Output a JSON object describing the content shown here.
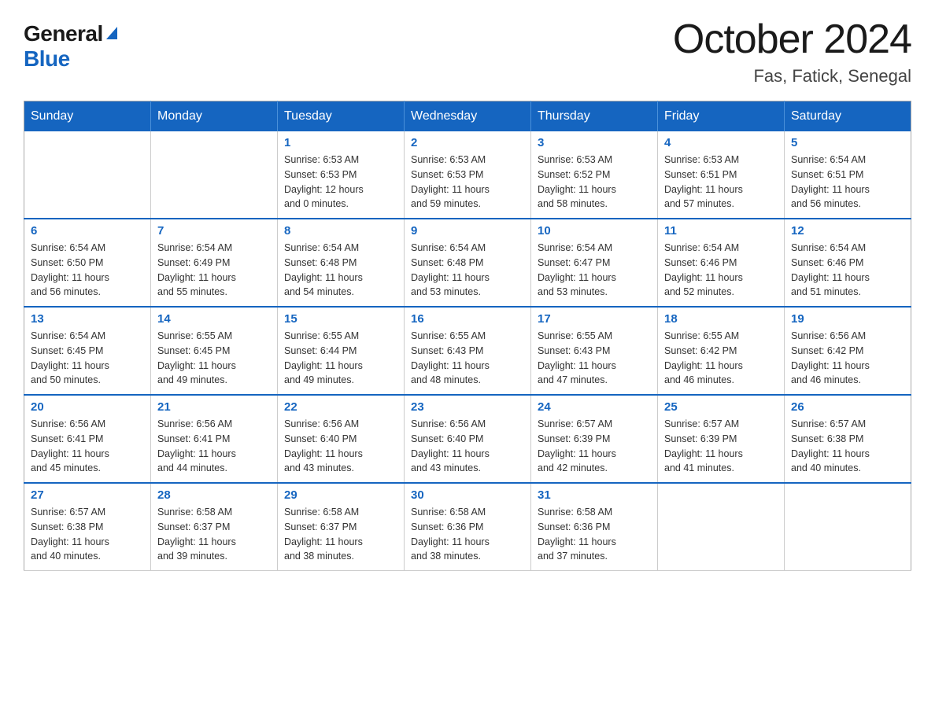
{
  "header": {
    "logo_general": "General",
    "logo_blue": "Blue",
    "title": "October 2024",
    "subtitle": "Fas, Fatick, Senegal"
  },
  "weekdays": [
    "Sunday",
    "Monday",
    "Tuesday",
    "Wednesday",
    "Thursday",
    "Friday",
    "Saturday"
  ],
  "weeks": [
    [
      {
        "day": "",
        "info": ""
      },
      {
        "day": "",
        "info": ""
      },
      {
        "day": "1",
        "info": "Sunrise: 6:53 AM\nSunset: 6:53 PM\nDaylight: 12 hours\nand 0 minutes."
      },
      {
        "day": "2",
        "info": "Sunrise: 6:53 AM\nSunset: 6:53 PM\nDaylight: 11 hours\nand 59 minutes."
      },
      {
        "day": "3",
        "info": "Sunrise: 6:53 AM\nSunset: 6:52 PM\nDaylight: 11 hours\nand 58 minutes."
      },
      {
        "day": "4",
        "info": "Sunrise: 6:53 AM\nSunset: 6:51 PM\nDaylight: 11 hours\nand 57 minutes."
      },
      {
        "day": "5",
        "info": "Sunrise: 6:54 AM\nSunset: 6:51 PM\nDaylight: 11 hours\nand 56 minutes."
      }
    ],
    [
      {
        "day": "6",
        "info": "Sunrise: 6:54 AM\nSunset: 6:50 PM\nDaylight: 11 hours\nand 56 minutes."
      },
      {
        "day": "7",
        "info": "Sunrise: 6:54 AM\nSunset: 6:49 PM\nDaylight: 11 hours\nand 55 minutes."
      },
      {
        "day": "8",
        "info": "Sunrise: 6:54 AM\nSunset: 6:48 PM\nDaylight: 11 hours\nand 54 minutes."
      },
      {
        "day": "9",
        "info": "Sunrise: 6:54 AM\nSunset: 6:48 PM\nDaylight: 11 hours\nand 53 minutes."
      },
      {
        "day": "10",
        "info": "Sunrise: 6:54 AM\nSunset: 6:47 PM\nDaylight: 11 hours\nand 53 minutes."
      },
      {
        "day": "11",
        "info": "Sunrise: 6:54 AM\nSunset: 6:46 PM\nDaylight: 11 hours\nand 52 minutes."
      },
      {
        "day": "12",
        "info": "Sunrise: 6:54 AM\nSunset: 6:46 PM\nDaylight: 11 hours\nand 51 minutes."
      }
    ],
    [
      {
        "day": "13",
        "info": "Sunrise: 6:54 AM\nSunset: 6:45 PM\nDaylight: 11 hours\nand 50 minutes."
      },
      {
        "day": "14",
        "info": "Sunrise: 6:55 AM\nSunset: 6:45 PM\nDaylight: 11 hours\nand 49 minutes."
      },
      {
        "day": "15",
        "info": "Sunrise: 6:55 AM\nSunset: 6:44 PM\nDaylight: 11 hours\nand 49 minutes."
      },
      {
        "day": "16",
        "info": "Sunrise: 6:55 AM\nSunset: 6:43 PM\nDaylight: 11 hours\nand 48 minutes."
      },
      {
        "day": "17",
        "info": "Sunrise: 6:55 AM\nSunset: 6:43 PM\nDaylight: 11 hours\nand 47 minutes."
      },
      {
        "day": "18",
        "info": "Sunrise: 6:55 AM\nSunset: 6:42 PM\nDaylight: 11 hours\nand 46 minutes."
      },
      {
        "day": "19",
        "info": "Sunrise: 6:56 AM\nSunset: 6:42 PM\nDaylight: 11 hours\nand 46 minutes."
      }
    ],
    [
      {
        "day": "20",
        "info": "Sunrise: 6:56 AM\nSunset: 6:41 PM\nDaylight: 11 hours\nand 45 minutes."
      },
      {
        "day": "21",
        "info": "Sunrise: 6:56 AM\nSunset: 6:41 PM\nDaylight: 11 hours\nand 44 minutes."
      },
      {
        "day": "22",
        "info": "Sunrise: 6:56 AM\nSunset: 6:40 PM\nDaylight: 11 hours\nand 43 minutes."
      },
      {
        "day": "23",
        "info": "Sunrise: 6:56 AM\nSunset: 6:40 PM\nDaylight: 11 hours\nand 43 minutes."
      },
      {
        "day": "24",
        "info": "Sunrise: 6:57 AM\nSunset: 6:39 PM\nDaylight: 11 hours\nand 42 minutes."
      },
      {
        "day": "25",
        "info": "Sunrise: 6:57 AM\nSunset: 6:39 PM\nDaylight: 11 hours\nand 41 minutes."
      },
      {
        "day": "26",
        "info": "Sunrise: 6:57 AM\nSunset: 6:38 PM\nDaylight: 11 hours\nand 40 minutes."
      }
    ],
    [
      {
        "day": "27",
        "info": "Sunrise: 6:57 AM\nSunset: 6:38 PM\nDaylight: 11 hours\nand 40 minutes."
      },
      {
        "day": "28",
        "info": "Sunrise: 6:58 AM\nSunset: 6:37 PM\nDaylight: 11 hours\nand 39 minutes."
      },
      {
        "day": "29",
        "info": "Sunrise: 6:58 AM\nSunset: 6:37 PM\nDaylight: 11 hours\nand 38 minutes."
      },
      {
        "day": "30",
        "info": "Sunrise: 6:58 AM\nSunset: 6:36 PM\nDaylight: 11 hours\nand 38 minutes."
      },
      {
        "day": "31",
        "info": "Sunrise: 6:58 AM\nSunset: 6:36 PM\nDaylight: 11 hours\nand 37 minutes."
      },
      {
        "day": "",
        "info": ""
      },
      {
        "day": "",
        "info": ""
      }
    ]
  ]
}
